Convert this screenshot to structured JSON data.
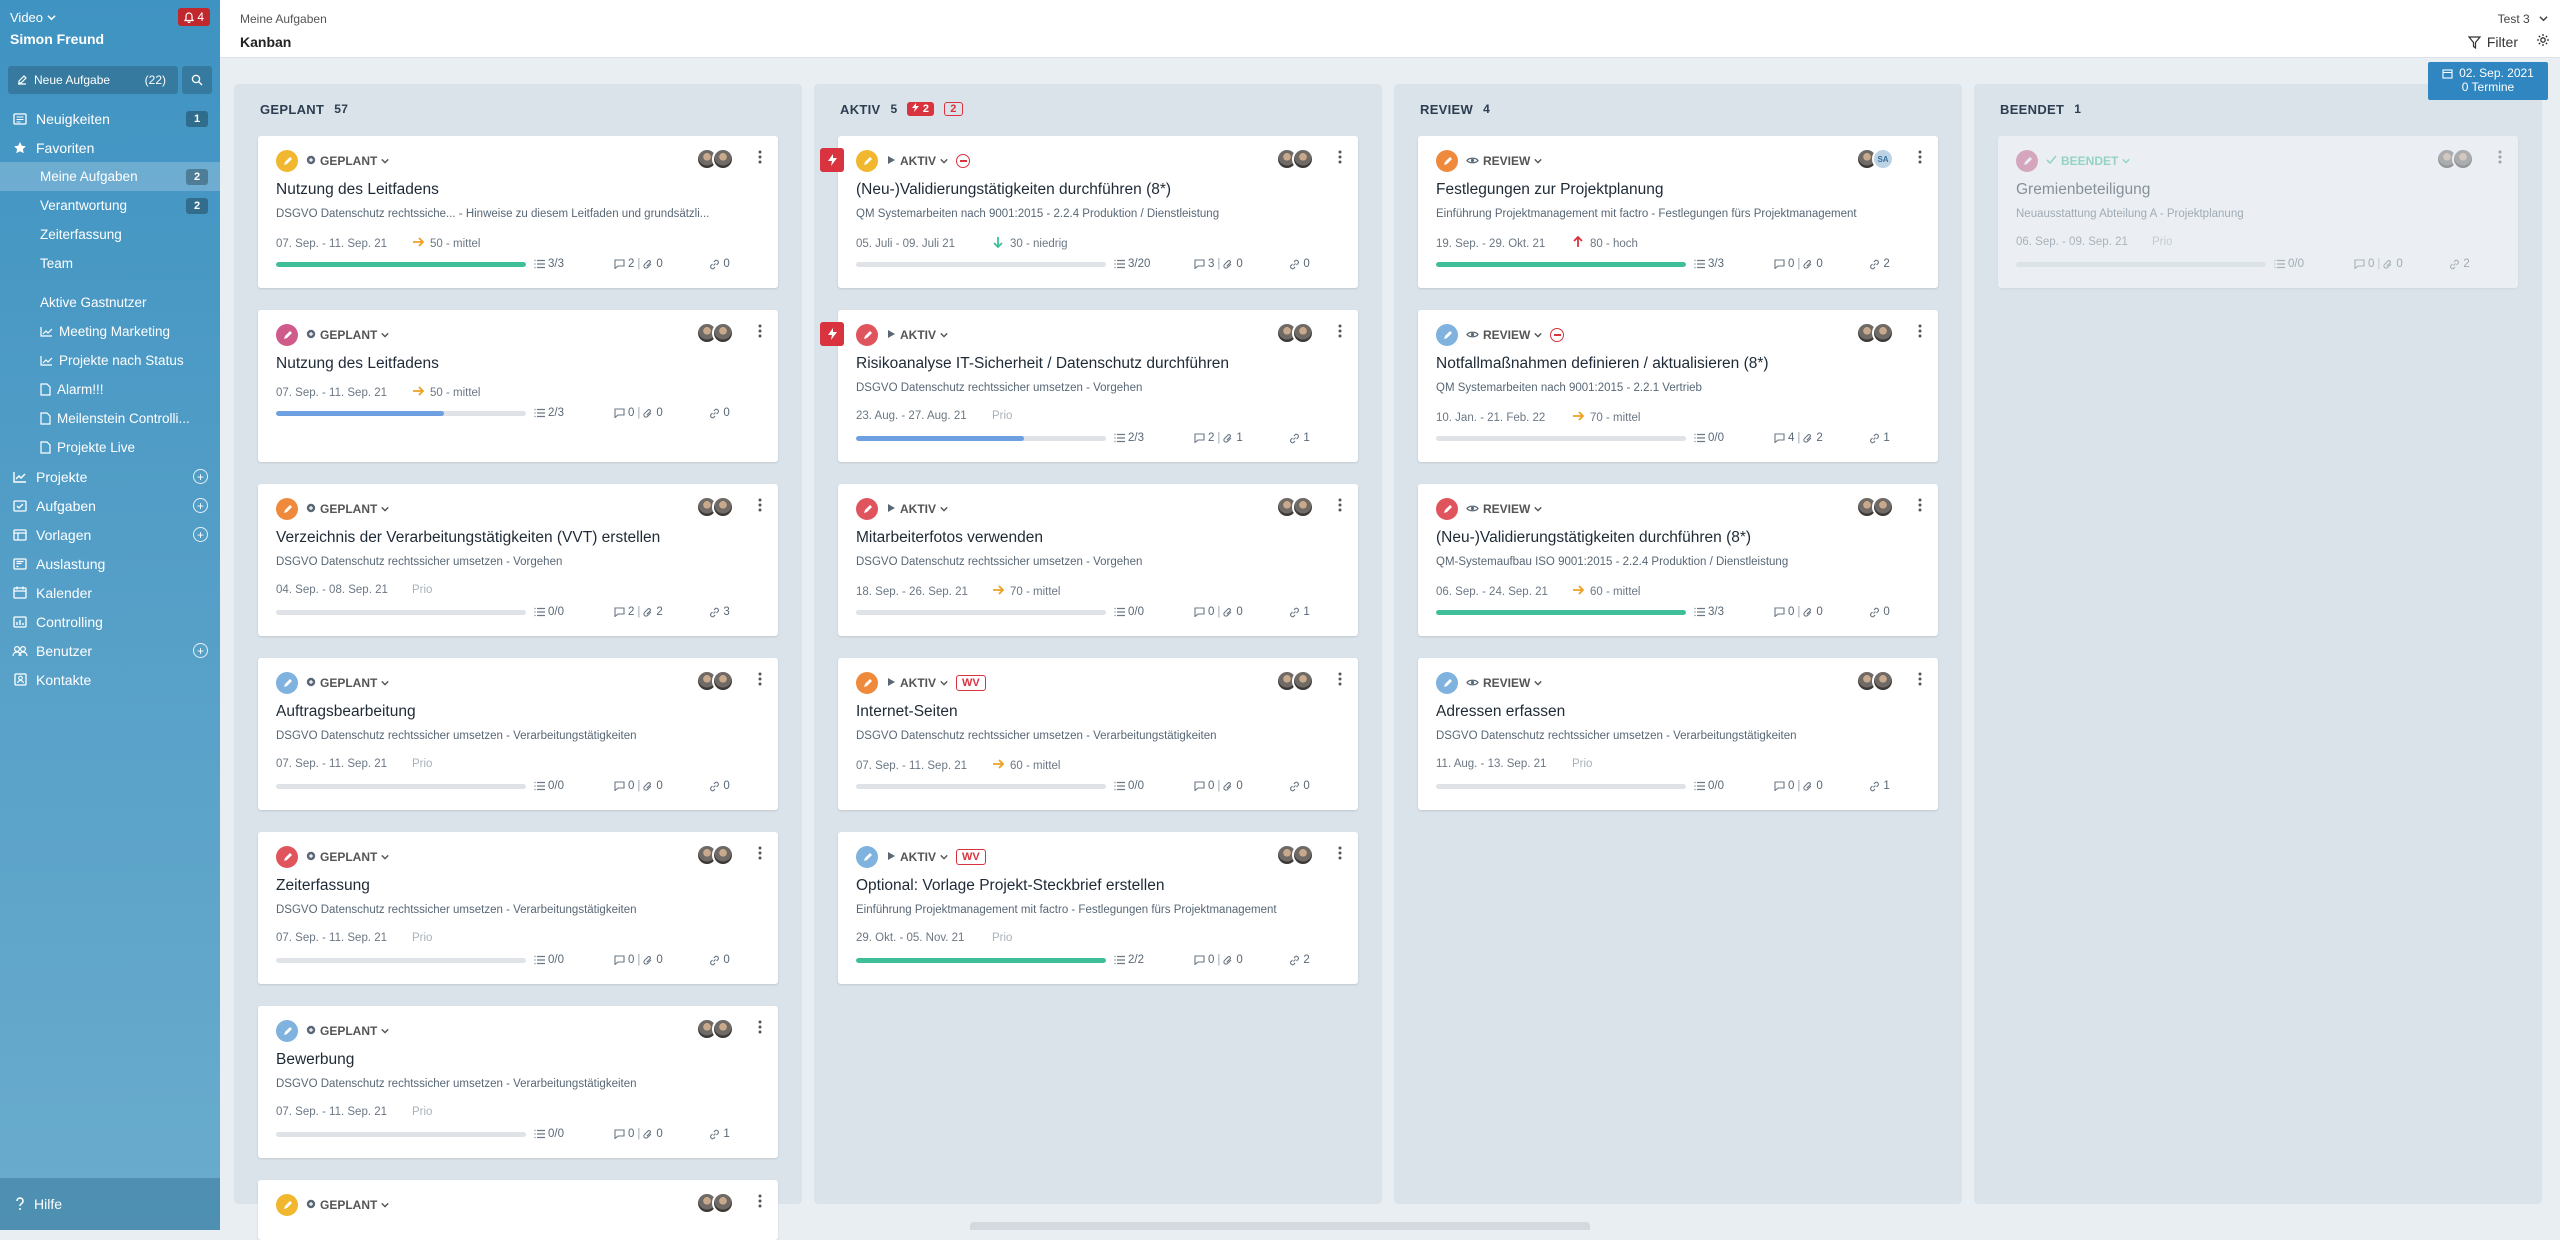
{
  "sidebar": {
    "app_name": "Video",
    "user_name": "Simon Freund",
    "notifications": "4",
    "new_task_label": "Neue Aufgabe",
    "new_task_count": "(22)",
    "items": [
      {
        "label": "Neuigkeiten",
        "badge": "1",
        "icon": "newspaper-icon"
      },
      {
        "label": "Favoriten",
        "icon": "star-icon"
      }
    ],
    "favorites": [
      {
        "label": "Meine Aufgaben",
        "badge": "2"
      },
      {
        "label": "Verantwortung",
        "badge": "2"
      },
      {
        "label": "Zeiterfassung"
      },
      {
        "label": "Team"
      },
      {
        "label": "Aktive Gastnutzer"
      },
      {
        "label": "Meeting Marketing",
        "icon": "chart-icon"
      },
      {
        "label": "Projekte nach Status",
        "icon": "chart-icon"
      },
      {
        "label": "Alarm!!!",
        "icon": "document-icon"
      },
      {
        "label": "Meilenstein Controlli...",
        "icon": "document-icon"
      },
      {
        "label": "Projekte Live",
        "icon": "document-icon"
      }
    ],
    "sections": [
      {
        "label": "Projekte",
        "plus": true,
        "icon": "chart-icon"
      },
      {
        "label": "Aufgaben",
        "plus": true,
        "icon": "tasks-icon"
      },
      {
        "label": "Vorlagen",
        "plus": true,
        "icon": "template-icon"
      },
      {
        "label": "Auslastung",
        "icon": "gauge-icon"
      },
      {
        "label": "Kalender",
        "icon": "calendar-icon"
      },
      {
        "label": "Controlling",
        "icon": "controlling-icon"
      },
      {
        "label": "Benutzer",
        "plus": true,
        "icon": "users-icon"
      },
      {
        "label": "Kontakte",
        "icon": "contacts-icon"
      }
    ],
    "help_label": "Hilfe"
  },
  "header": {
    "breadcrumb": "Meine Aufgaben",
    "title": "Kanban",
    "workspace": "Test 3",
    "filter_label": "Filter",
    "date": "02. Sep. 2021",
    "appointments": "0 Termine"
  },
  "colors": {
    "red": "#d8333f",
    "green": "#3fbf99",
    "blue": "#6e9fe0",
    "yellow": "#f0b72f",
    "orange": "#ef8a3c",
    "pink": "#cf5b8a",
    "lightblue": "#7fb2de"
  },
  "columns": [
    {
      "name": "GEPLANT",
      "count": "57",
      "cards": [
        {
          "status": "GEPLANT",
          "icon_color": "#f0b72f",
          "title": "Nutzung des Leitfadens",
          "subtitle": "DSGVO Datenschutz rechtssiche... - Hinweise zu diesem Leitfaden und grundsätzli...",
          "dates": "07. Sep. - 11. Sep. 21",
          "prio": "50 - mittel",
          "prio_dir": "right",
          "progress": 1.0,
          "progress_color": "#3fbf99",
          "checks": "3/3",
          "comments": "2",
          "attach": "0",
          "links": "0"
        },
        {
          "status": "GEPLANT",
          "icon_color": "#cf5b8a",
          "title": "Nutzung des Leitfadens",
          "subtitle": "",
          "dates": "07. Sep. - 11. Sep. 21",
          "prio": "50 - mittel",
          "prio_dir": "right",
          "progress": 0.67,
          "progress_color": "#6e9fe0",
          "checks": "2/3",
          "comments": "0",
          "attach": "0",
          "links": "0"
        },
        {
          "status": "GEPLANT",
          "icon_color": "#ef8a3c",
          "title": "Verzeichnis der Verarbeitungstätigkeiten (VVT) erstellen",
          "subtitle": "DSGVO Datenschutz rechtssicher umsetzen - Vorgehen",
          "dates": "04. Sep. - 08. Sep. 21",
          "prio": "Prio",
          "prio_dir": "none",
          "progress": 0,
          "progress_color": "#6e9fe0",
          "checks": "0/0",
          "comments": "2",
          "attach": "2",
          "links": "3"
        },
        {
          "status": "GEPLANT",
          "icon_color": "#7fb2de",
          "title": "Auftragsbearbeitung",
          "subtitle": "DSGVO Datenschutz rechtssicher umsetzen - Verarbeitungstätigkeiten",
          "dates": "07. Sep. - 11. Sep. 21",
          "prio": "Prio",
          "prio_dir": "none",
          "progress": 0,
          "progress_color": "#6e9fe0",
          "checks": "0/0",
          "comments": "0",
          "attach": "0",
          "links": "0"
        },
        {
          "status": "GEPLANT",
          "icon_color": "#e0555d",
          "title": "Zeiterfassung",
          "subtitle": "DSGVO Datenschutz rechtssicher umsetzen - Verarbeitungstätigkeiten",
          "dates": "07. Sep. - 11. Sep. 21",
          "prio": "Prio",
          "prio_dir": "none",
          "progress": 0,
          "progress_color": "#6e9fe0",
          "checks": "0/0",
          "comments": "0",
          "attach": "0",
          "links": "0"
        },
        {
          "status": "GEPLANT",
          "icon_color": "#7fb2de",
          "title": "Bewerbung",
          "subtitle": "DSGVO Datenschutz rechtssicher umsetzen - Verarbeitungstätigkeiten",
          "dates": "07. Sep. - 11. Sep. 21",
          "prio": "Prio",
          "prio_dir": "none",
          "progress": 0,
          "progress_color": "#6e9fe0",
          "checks": "0/0",
          "comments": "0",
          "attach": "0",
          "links": "1"
        },
        {
          "status": "GEPLANT",
          "icon_color": "#f0b72f",
          "title": "",
          "subtitle": "",
          "dates": "",
          "prio": "",
          "prio_dir": "none",
          "progress": 0,
          "progress_color": "#6e9fe0",
          "checks": "",
          "comments": "",
          "attach": "",
          "links": "",
          "partial": true
        }
      ]
    },
    {
      "name": "AKTIV",
      "count": "5",
      "flash_count": "2",
      "outline_count": "2",
      "cards": [
        {
          "status": "AKTIV",
          "flash": true,
          "blocked": true,
          "icon_color": "#f0b72f",
          "title": "(Neu-)Validierungstätigkeiten durchführen (8*)",
          "subtitle": "QM Systemarbeiten nach 9001:2015 - 2.2.4 Produktion / Dienstleistung",
          "dates": "05. Juli - 09. Juli 21",
          "prio": "30 - niedrig",
          "prio_dir": "down",
          "progress": 0,
          "progress_color": "#6e9fe0",
          "checks": "3/20",
          "comments": "3",
          "attach": "0",
          "links": "0"
        },
        {
          "status": "AKTIV",
          "flash": true,
          "icon_color": "#e0555d",
          "title": "Risikoanalyse IT-Sicherheit / Datenschutz durchführen",
          "subtitle": "DSGVO Datenschutz rechtssicher umsetzen - Vorgehen",
          "dates": "23. Aug. - 27. Aug. 21",
          "prio": "Prio",
          "prio_dir": "none",
          "progress": 0.67,
          "progress_color": "#6e9fe0",
          "checks": "2/3",
          "comments": "2",
          "attach": "1",
          "links": "1"
        },
        {
          "status": "AKTIV",
          "icon_color": "#e0555d",
          "title": "Mitarbeiterfotos verwenden",
          "subtitle": "DSGVO Datenschutz rechtssicher umsetzen - Vorgehen",
          "dates": "18. Sep. - 26. Sep. 21",
          "prio": "70 - mittel",
          "prio_dir": "right",
          "progress": 0,
          "progress_color": "#6e9fe0",
          "checks": "0/0",
          "comments": "0",
          "attach": "0",
          "links": "1"
        },
        {
          "status": "AKTIV",
          "wv": "WV",
          "icon_color": "#ef8a3c",
          "title": "Internet-Seiten",
          "subtitle": "DSGVO Datenschutz rechtssicher umsetzen - Verarbeitungstätigkeiten",
          "dates": "07. Sep. - 11. Sep. 21",
          "prio": "60 - mittel",
          "prio_dir": "right",
          "progress": 0,
          "progress_color": "#6e9fe0",
          "checks": "0/0",
          "comments": "0",
          "attach": "0",
          "links": "0"
        },
        {
          "status": "AKTIV",
          "wv": "WV",
          "icon_color": "#7fb2de",
          "title": "Optional: Vorlage Projekt-Steckbrief erstellen",
          "subtitle": "Einführung Projektmanagement mit factro - Festlegungen fürs Projektmanagement",
          "dates": "29. Okt. - 05. Nov. 21",
          "prio": "Prio",
          "prio_dir": "none",
          "progress": 1.0,
          "progress_color": "#3fbf99",
          "checks": "2/2",
          "comments": "0",
          "attach": "0",
          "links": "2"
        }
      ]
    },
    {
      "name": "REVIEW",
      "count": "4",
      "cards": [
        {
          "status": "REVIEW",
          "icon_color": "#ef8a3c",
          "sa": true,
          "title": "Festlegungen zur Projektplanung",
          "subtitle": "Einführung Projektmanagement mit factro - Festlegungen fürs Projektmanagement",
          "dates": "19. Sep. - 29. Okt. 21",
          "prio": "80 - hoch",
          "prio_dir": "up",
          "progress": 1.0,
          "progress_color": "#3fbf99",
          "checks": "3/3",
          "comments": "0",
          "attach": "0",
          "links": "2"
        },
        {
          "status": "REVIEW",
          "blocked": true,
          "icon_color": "#7fb2de",
          "title": "Notfallmaßnahmen definieren / aktualisieren (8*)",
          "subtitle": "QM Systemarbeiten nach 9001:2015 - 2.2.1 Vertrieb",
          "dates": "10. Jan. - 21. Feb. 22",
          "prio": "70 - mittel",
          "prio_dir": "right",
          "progress": 0,
          "progress_color": "#6e9fe0",
          "checks": "0/0",
          "comments": "4",
          "attach": "2",
          "links": "1"
        },
        {
          "status": "REVIEW",
          "icon_color": "#e0555d",
          "title": "(Neu-)Validierungstätigkeiten durchführen (8*)",
          "subtitle": "QM-Systemaufbau ISO 9001:2015 - 2.2.4 Produktion / Dienstleistung",
          "dates": "06. Sep. - 24. Sep. 21",
          "prio": "60 - mittel",
          "prio_dir": "right",
          "progress": 1.0,
          "progress_color": "#3fbf99",
          "checks": "3/3",
          "comments": "0",
          "attach": "0",
          "links": "0"
        },
        {
          "status": "REVIEW",
          "icon_color": "#7fb2de",
          "title": "Adressen erfassen",
          "subtitle": "DSGVO Datenschutz rechtssicher umsetzen - Verarbeitungstätigkeiten",
          "dates": "11. Aug. - 13. Sep. 21",
          "prio": "Prio",
          "prio_dir": "none",
          "progress": 0,
          "progress_color": "#6e9fe0",
          "checks": "0/0",
          "comments": "0",
          "attach": "0",
          "links": "1"
        }
      ]
    },
    {
      "name": "BEENDET",
      "count": "1",
      "cards": [
        {
          "status": "BEENDET",
          "faded": true,
          "icon_color": "#cf5b8a",
          "title": "Gremienbeteiligung",
          "subtitle": "Neuausstattung Abteilung A - Projektplanung",
          "dates": "06. Sep. - 09. Sep. 21",
          "prio": "Prio",
          "prio_dir": "none",
          "progress": 0,
          "progress_color": "#6e9fe0",
          "checks": "0/0",
          "comments": "0",
          "attach": "0",
          "links": "2"
        }
      ]
    }
  ]
}
